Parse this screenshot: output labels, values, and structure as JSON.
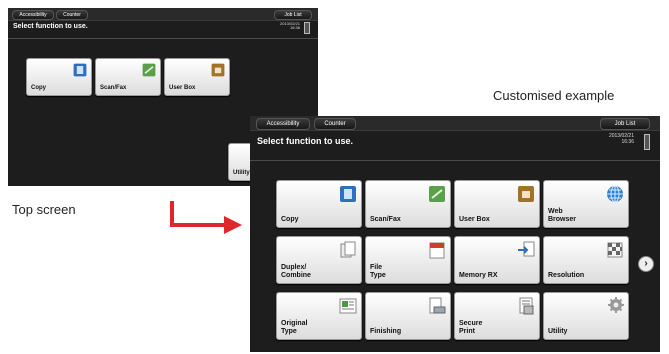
{
  "captions": {
    "customised": "Customised example",
    "top_screen": "Top screen"
  },
  "small_screen": {
    "accessibility": "Accessibility",
    "counter": "Counter",
    "job_list": "Job List",
    "headline": "Select function to use.",
    "date": "2013/02/21",
    "time": "16:36",
    "tiles": [
      "Copy",
      "Scan/Fax",
      "User Box",
      "Utility"
    ]
  },
  "large_screen": {
    "accessibility": "Accessibility",
    "counter": "Counter",
    "job_list": "Job List",
    "headline": "Select function to use.",
    "date": "2013/02/21",
    "time": "16:36",
    "tiles": [
      "Copy",
      "Scan/Fax",
      "User Box",
      "Web\nBrowser",
      "Duplex/\nCombine",
      "File\nType",
      "Memory RX",
      "Resolution",
      "Original\nType",
      "Finishing",
      "Secure\nPrint",
      "Utility"
    ],
    "next_glyph": "›"
  },
  "icons": {
    "copy": "copy-icon",
    "scan": "scan-fax-icon",
    "box": "user-box-icon",
    "globe": "web-browser-icon",
    "duplex": "duplex-combine-icon",
    "file": "file-type-icon",
    "memory": "memory-rx-icon",
    "resolution": "resolution-icon",
    "original": "original-type-icon",
    "finishing": "finishing-icon",
    "secure": "secure-print-icon",
    "gear": "utility-gear-icon"
  },
  "colors": {
    "panel": "#1d1d1d",
    "arrow": "#e0262a",
    "copy_icon": "#2f6fc0",
    "scan_icon": "#5aa04a",
    "box_icon": "#a0722a",
    "globe_icon": "#2f7fd0"
  }
}
